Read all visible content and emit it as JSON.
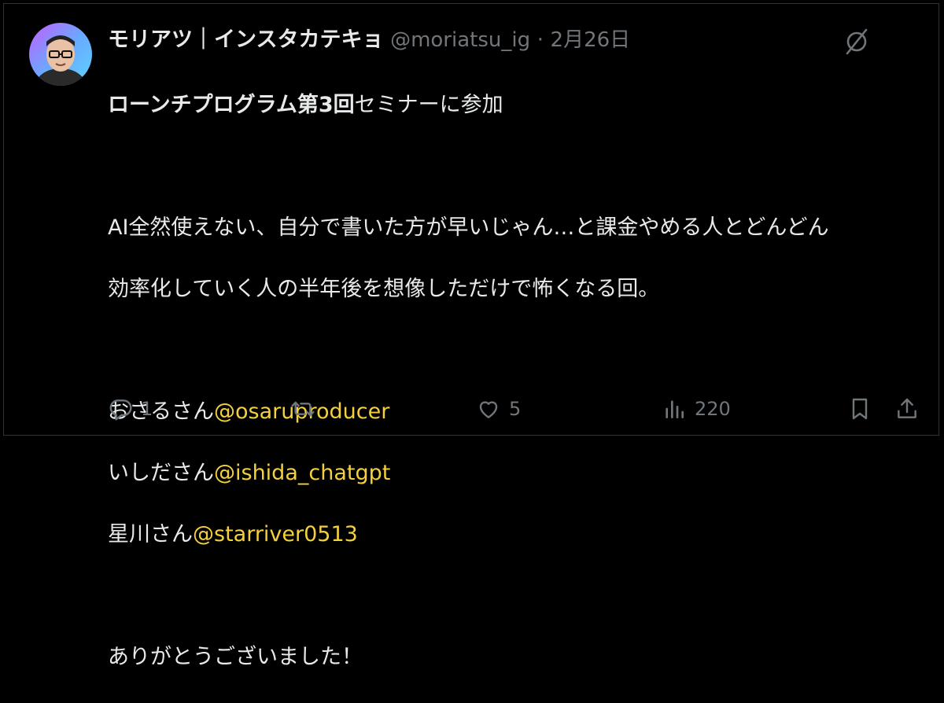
{
  "tweet": {
    "display_name": "モリアツ｜インスタカテキョ",
    "handle": "@moriatsu_ig",
    "separator": "·",
    "date": "2月26日",
    "line1_bold": "ローンチプログラム",
    "line1_mid": "第3回",
    "line1_rest": "セミナーに参加",
    "para2_line1": "AI全然使えない、自分で書いた方が早いじゃん…と課金やめる人とどんどん",
    "para2_line2": "効率化していく人の半年後を想像しただけで怖くなる回。",
    "thanks": [
      {
        "prefix": "おさるさん",
        "mention": "@osaruproducer"
      },
      {
        "prefix": "いしださん",
        "mention": "@ishida_chatgpt"
      },
      {
        "prefix": "星川さん",
        "mention": "@starriver0513"
      }
    ],
    "closing": "ありがとうございました！"
  },
  "actions": {
    "reply_count": "1",
    "retweet_count": "",
    "like_count": "5",
    "views_count": "220"
  },
  "colors": {
    "background": "#000000",
    "text": "#e7e9ea",
    "muted": "#71767b",
    "mention": "#f4d03f"
  },
  "icons": [
    "avatar",
    "grok-icon",
    "reply-icon",
    "retweet-icon",
    "like-icon",
    "views-icon",
    "bookmark-icon",
    "share-icon"
  ]
}
